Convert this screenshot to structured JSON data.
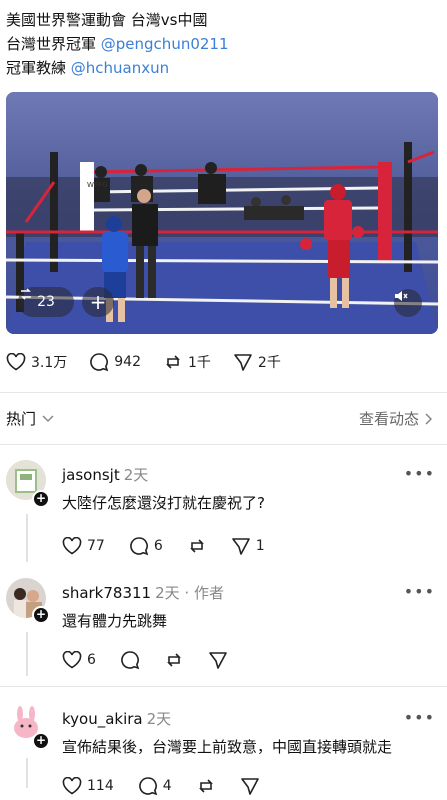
{
  "post": {
    "line1": "美國世界警運動會 台灣vs中國",
    "line2_prefix": "台灣世界冠軍 ",
    "line2_mention": "@pengchun0211",
    "line3_prefix": "冠軍教練 ",
    "line3_mention": "@hchuanxun"
  },
  "video": {
    "repost_count": "23",
    "add_label": "+",
    "mute_icon": "speaker-muted-icon",
    "ring_text": "WPFG"
  },
  "post_actions": {
    "likes": "3.1万",
    "comments": "942",
    "reposts": "1千",
    "shares": "2千"
  },
  "sort": {
    "label": "热门",
    "activity": "查看动态"
  },
  "comments": [
    {
      "username": "jasonsjt",
      "time": "2天",
      "tag": "",
      "text": "大陸仔怎麼還沒打就在慶祝了?",
      "likes": "77",
      "replies": "6",
      "reposts": "",
      "shares": "1"
    },
    {
      "username": "shark78311",
      "time": "2天",
      "tag": "· 作者",
      "text": "還有體力先跳舞",
      "likes": "6",
      "replies": "",
      "reposts": "",
      "shares": ""
    },
    {
      "username": "kyou_akira",
      "time": "2天",
      "tag": "",
      "text": "宣佈結果後，台灣要上前致意，中國直接轉頭就走",
      "likes": "114",
      "replies": "4",
      "reposts": "",
      "shares": ""
    }
  ],
  "colors": {
    "mention": "#3b7fd6",
    "ring_red": "#d8243a",
    "mat_blue": "#3d4fa8"
  }
}
